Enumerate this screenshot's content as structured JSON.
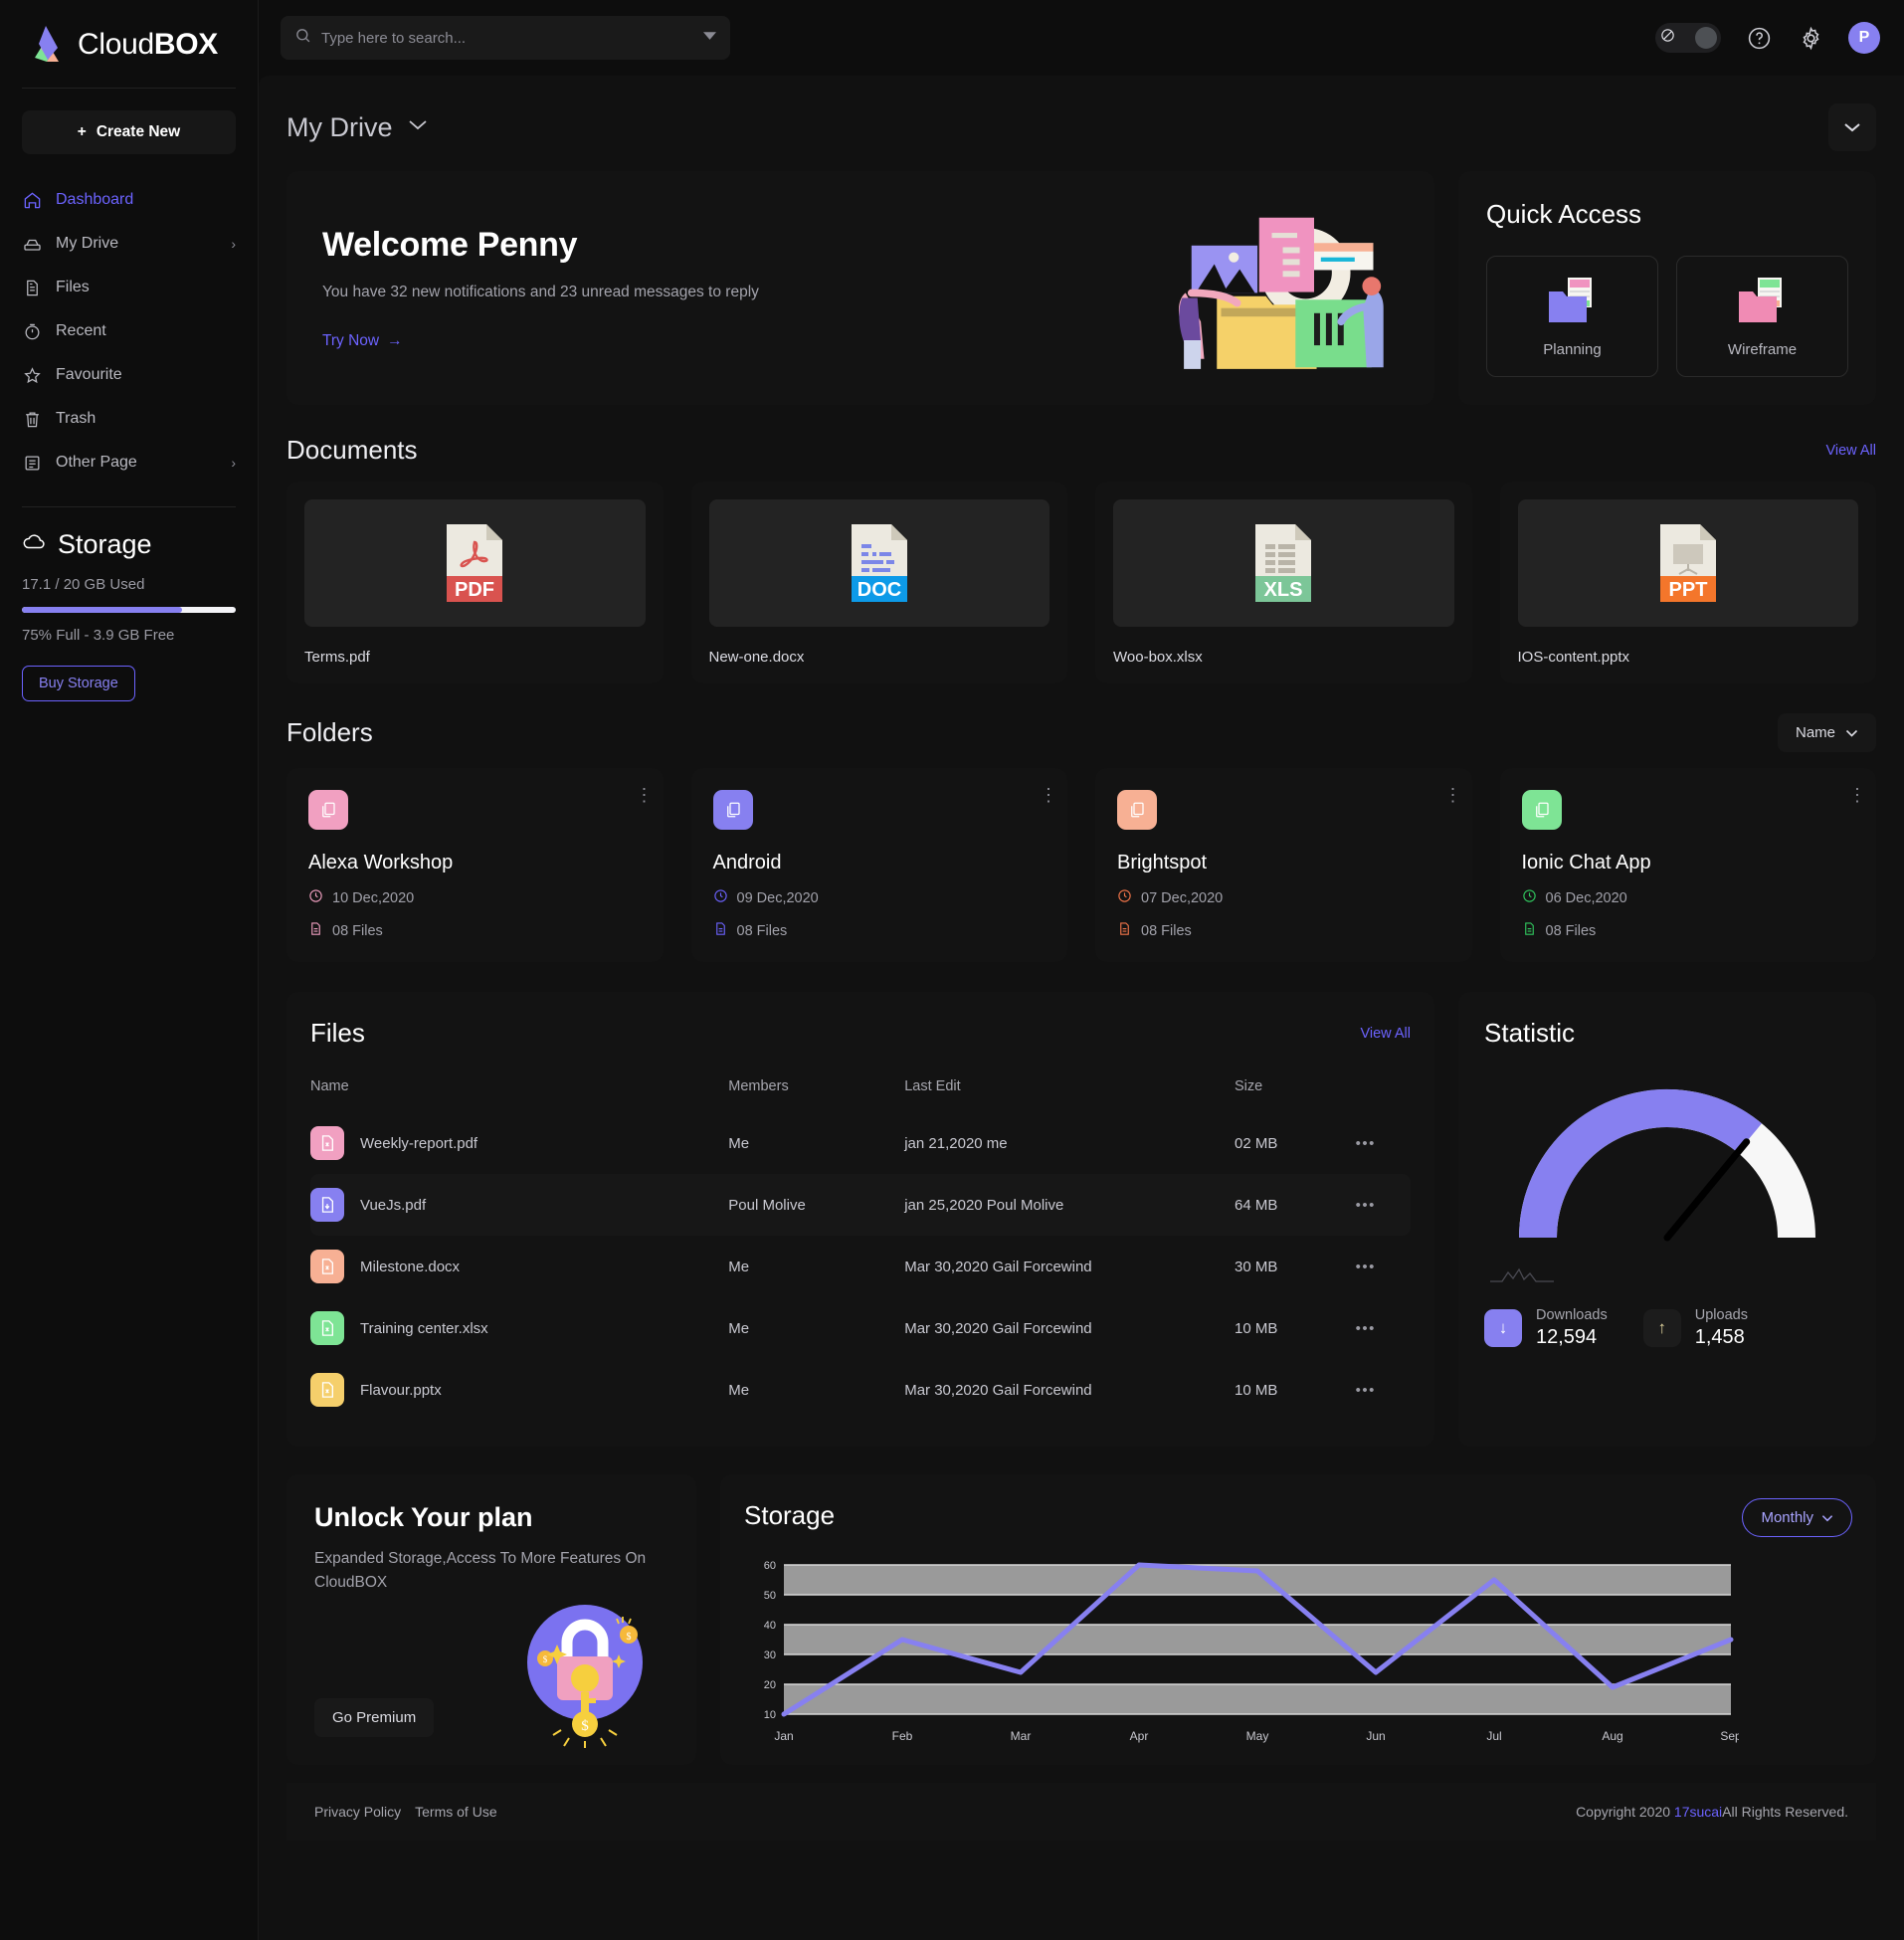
{
  "brand": {
    "name_light": "Cloud",
    "name_bold": "BOX"
  },
  "sidebar": {
    "create_label": "Create New",
    "items": [
      {
        "label": "Dashboard",
        "icon": "home-icon"
      },
      {
        "label": "My Drive",
        "icon": "drive-icon"
      },
      {
        "label": "Files",
        "icon": "file-icon"
      },
      {
        "label": "Recent",
        "icon": "clock-icon"
      },
      {
        "label": "Favourite",
        "icon": "star-icon"
      },
      {
        "label": "Trash",
        "icon": "trash-icon"
      },
      {
        "label": "Other Page",
        "icon": "list-icon"
      }
    ],
    "storage": {
      "title": "Storage",
      "used": "17.1 / 20 GB Used",
      "free": "75% Full - 3.9 GB Free",
      "percent": 75,
      "buy_label": "Buy Storage",
      "fill_color": "#8780f0"
    }
  },
  "topbar": {
    "search_placeholder": "Type here to search...",
    "search_value": "",
    "avatar_initial": "P"
  },
  "breadcrumb": {
    "title": "My Drive"
  },
  "welcome": {
    "heading": "Welcome Penny",
    "subtitle": "You have 32 new notifications and 23 unread messages to reply",
    "cta": "Try Now"
  },
  "quick_access": {
    "title": "Quick Access",
    "items": [
      {
        "label": "Planning",
        "color": "#8780f0"
      },
      {
        "label": "Wireframe",
        "color": "#f08bb4"
      }
    ]
  },
  "documents": {
    "title": "Documents",
    "view_all": "View All",
    "items": [
      {
        "name": "Terms.pdf",
        "type": "PDF",
        "color": "#d9534f"
      },
      {
        "name": "New-one.docx",
        "type": "DOC",
        "color": "#0d9ae8"
      },
      {
        "name": "Woo-box.xlsx",
        "type": "XLS",
        "color": "#7cc698"
      },
      {
        "name": "IOS-content.pptx",
        "type": "PPT",
        "color": "#f4762b"
      }
    ]
  },
  "folders": {
    "title": "Folders",
    "sort_label": "Name",
    "items": [
      {
        "name": "Alexa Workshop",
        "date": "10 Dec,2020",
        "files": "08 Files",
        "color": "#f1a0c1"
      },
      {
        "name": "Android",
        "date": "09 Dec,2020",
        "files": "08 Files",
        "color": "#8780f0"
      },
      {
        "name": "Brightspot",
        "date": "07 Dec,2020",
        "files": "08 Files",
        "color": "#f7b094"
      },
      {
        "name": "Ionic Chat App",
        "date": "06 Dec,2020",
        "files": "08 Files",
        "color": "#7ee495"
      }
    ]
  },
  "files": {
    "title": "Files",
    "view_all": "View All",
    "columns": [
      "Name",
      "Members",
      "Last Edit",
      "Size"
    ],
    "rows": [
      {
        "name": "Weekly-report.pdf",
        "members": "Me",
        "last_edit": "jan 21,2020 me",
        "size": "02 MB",
        "color": "#f1a0c1",
        "selected": false
      },
      {
        "name": "VueJs.pdf",
        "members": "Poul Molive",
        "last_edit": "jan 25,2020 Poul Molive",
        "size": "64 MB",
        "color": "#8780f0",
        "selected": true
      },
      {
        "name": "Milestone.docx",
        "members": "Me",
        "last_edit": "Mar 30,2020 Gail Forcewind",
        "size": "30 MB",
        "color": "#f7b094",
        "selected": false
      },
      {
        "name": "Training center.xlsx",
        "members": "Me",
        "last_edit": "Mar 30,2020 Gail Forcewind",
        "size": "10 MB",
        "color": "#7ee495",
        "selected": false
      },
      {
        "name": "Flavour.pptx",
        "members": "Me",
        "last_edit": "Mar 30,2020 Gail Forcewind",
        "size": "10 MB",
        "color": "#f5cf6b",
        "selected": false
      }
    ]
  },
  "statistic": {
    "title": "Statistic",
    "downloads_label": "Downloads",
    "downloads_value": "12,594",
    "uploads_label": "Uploads",
    "uploads_value": "1,458",
    "chart_data": {
      "type": "pie",
      "title": "Statistic",
      "subtype": "gauge",
      "categories": [
        "Downloads",
        "Uploads"
      ],
      "values": [
        12594,
        1458
      ],
      "gauge_percent": 72,
      "colors": [
        "#8780f0",
        "#f7f7f7"
      ]
    }
  },
  "unlock": {
    "title": "Unlock Your plan",
    "subtitle": "Expanded Storage,Access To More Features On CloudBOX",
    "cta": "Go Premium"
  },
  "storage_chart": {
    "title": "Storage",
    "range_label": "Monthly"
  },
  "chart_data": {
    "type": "line",
    "title": "Storage",
    "xlabel": "",
    "ylabel": "",
    "categories": [
      "Jan",
      "Feb",
      "Mar",
      "Apr",
      "May",
      "Jun",
      "Jul",
      "Aug",
      "Sep"
    ],
    "values": [
      10,
      35,
      24,
      60,
      58,
      24,
      55,
      19,
      35
    ],
    "yticks": [
      10,
      20,
      30,
      40,
      50,
      60
    ],
    "ylim": [
      10,
      60
    ],
    "grid": true,
    "legend": "none",
    "line_color": "#8780f0"
  },
  "footer": {
    "privacy": "Privacy Policy",
    "terms": "Terms of Use",
    "copy_prefix": "Copyright 2020 ",
    "copy_link": "17sucai",
    "copy_suffix": "All Rights Reserved."
  }
}
